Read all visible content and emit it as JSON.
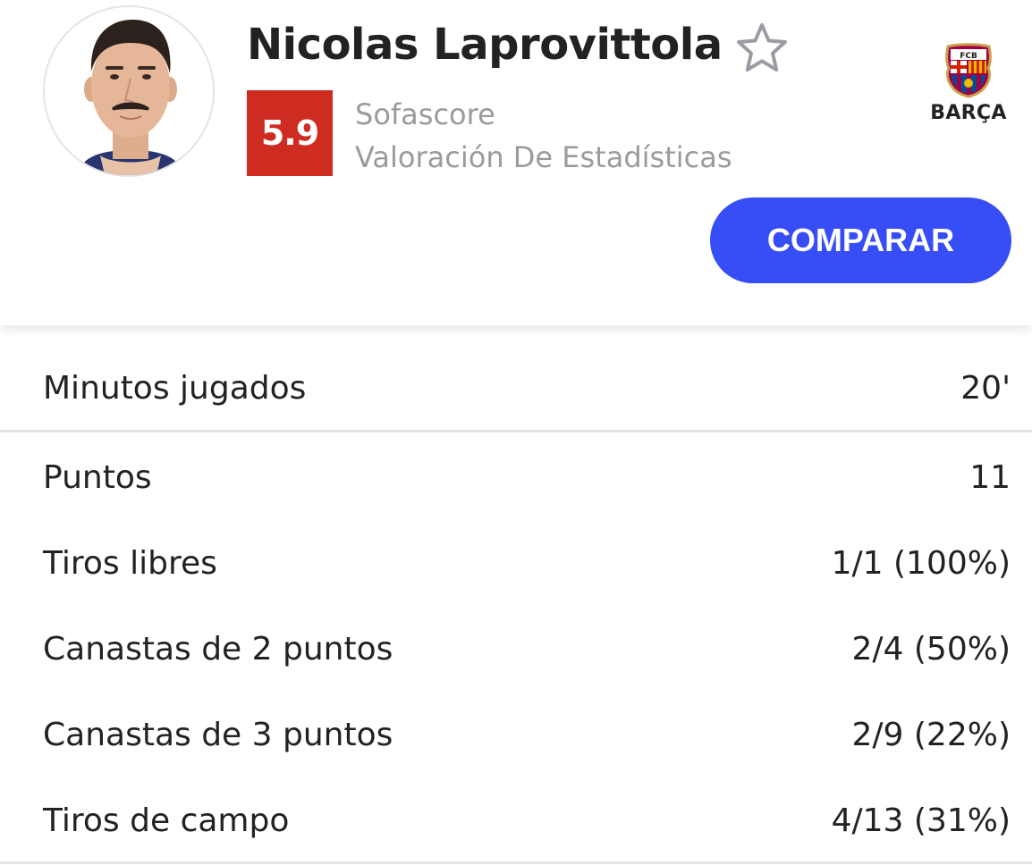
{
  "player": {
    "name": "Nicolas Laprovittola",
    "rating": "5.9",
    "rating_source_line1": "Sofascore",
    "rating_source_line2": "Valoración De Estadísticas"
  },
  "club": {
    "name": "BARÇA",
    "logo_text": "FCB"
  },
  "actions": {
    "compare_label": "COMPARAR"
  },
  "colors": {
    "rating_bg": "#cf2c21",
    "compare_button_bg": "#374df5"
  },
  "icons": {
    "favorite": "star-outline-icon",
    "club": "fc-barcelona-crest-icon"
  },
  "stats": [
    {
      "label": "Minutos jugados",
      "value": "20'"
    },
    {
      "label": "Puntos",
      "value": "11"
    },
    {
      "label": "Tiros libres",
      "value": "1/1 (100%)"
    },
    {
      "label": "Canastas de 2 puntos",
      "value": "2/4 (50%)"
    },
    {
      "label": "Canastas de 3 puntos",
      "value": "2/9 (22%)"
    },
    {
      "label": "Tiros de campo",
      "value": "4/13 (31%)"
    }
  ]
}
